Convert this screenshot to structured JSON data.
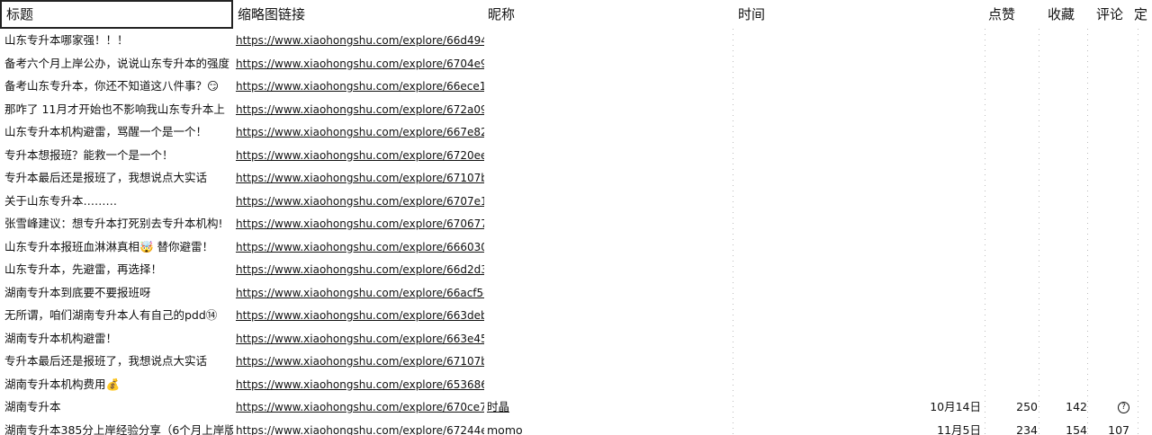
{
  "headers": {
    "title": "标题",
    "link": "缩略图链接",
    "nickname": "昵称",
    "time": "时间",
    "likes": "点赞",
    "favorites": "收藏",
    "comments": "评论",
    "more": "定"
  },
  "rows": [
    {
      "title": "山东专升本哪家强！！！",
      "link": "https://www.xiaohongshu.com/explore/66d4947200",
      "nickname": "",
      "time": "",
      "likes": "",
      "favorites": "",
      "comments": ""
    },
    {
      "title": "备考六个月上岸公办，说说山东专升本的强度",
      "link": "https://www.xiaohongshu.com/explore/6704e9a700",
      "nickname": "",
      "time": "",
      "likes": "",
      "favorites": "",
      "comments": ""
    },
    {
      "title": "备考山东专升本，你还不知道这八件事？😏",
      "link": "https://www.xiaohongshu.com/explore/66ece10800",
      "nickname": "",
      "time": "",
      "likes": "",
      "favorites": "",
      "comments": ""
    },
    {
      "title": "那咋了 11月才开始也不影响我山东专升本上",
      "link": "https://www.xiaohongshu.com/explore/672a09f900",
      "nickname": "",
      "time": "",
      "likes": "",
      "favorites": "",
      "comments": ""
    },
    {
      "title": "山东专升本机构避雷，骂醒一个是一个！",
      "link": "https://www.xiaohongshu.com/explore/667e822400",
      "nickname": "",
      "time": "",
      "likes": "",
      "favorites": "",
      "comments": ""
    },
    {
      "title": "专升本想报班？能救一个是一个！",
      "link": "https://www.xiaohongshu.com/explore/6720eebb00",
      "nickname": "",
      "time": "",
      "likes": "",
      "favorites": "",
      "comments": ""
    },
    {
      "title": "专升本最后还是报班了，我想说点大实话",
      "link": "https://www.xiaohongshu.com/explore/67107b0700",
      "nickname": "",
      "time": "",
      "likes": "",
      "favorites": "",
      "comments": ""
    },
    {
      "title": "关于山东专升本………",
      "link": "https://www.xiaohongshu.com/explore/6707e14c00",
      "nickname": "",
      "time": "",
      "likes": "",
      "favorites": "",
      "comments": ""
    },
    {
      "title": "张雪峰建议：想专升本打死别去专升本机构!",
      "link": "https://www.xiaohongshu.com/explore/6706773e00",
      "nickname": "",
      "time": "",
      "likes": "",
      "favorites": "",
      "comments": ""
    },
    {
      "title": "山东专升本报班血淋淋真相🤯 替你避雷！",
      "link": "https://www.xiaohongshu.com/explore/6660303e00",
      "nickname": "",
      "time": "",
      "likes": "",
      "favorites": "",
      "comments": ""
    },
    {
      "title": "山东专升本，先避雷，再选择！",
      "link": "https://www.xiaohongshu.com/explore/66d2d37900",
      "nickname": "",
      "time": "",
      "likes": "",
      "favorites": "",
      "comments": ""
    },
    {
      "title": "湖南专升本到底要不要报班呀",
      "link": "https://www.xiaohongshu.com/explore/66acf5d100",
      "nickname": "",
      "time": "",
      "likes": "",
      "favorites": "",
      "comments": ""
    },
    {
      "title": "无所谓，咱们湖南专升本人有自己的pdd⑭",
      "link": "https://www.xiaohongshu.com/explore/663debb200",
      "nickname": "",
      "time": "",
      "likes": "",
      "favorites": "",
      "comments": ""
    },
    {
      "title": "湖南专升本机构避雷！",
      "link": "https://www.xiaohongshu.com/explore/663e458d00",
      "nickname": "",
      "time": "",
      "likes": "",
      "favorites": "",
      "comments": ""
    },
    {
      "title": "专升本最后还是报班了，我想说点大实话",
      "link": "https://www.xiaohongshu.com/explore/67107b0700",
      "nickname": "",
      "time": "",
      "likes": "",
      "favorites": "",
      "comments": ""
    },
    {
      "title": "湖南专升本机构费用💰",
      "link": "https://www.xiaohongshu.com/explore/6536860e00",
      "nickname": "",
      "time": "",
      "likes": "",
      "favorites": "",
      "comments": ""
    },
    {
      "title": "湖南专升本",
      "link": "https://www.xiaohongshu.com/explore/670ce74100",
      "nickname": "时晶",
      "time": "10月14日",
      "likes": "250",
      "favorites": "142",
      "comments": "?"
    },
    {
      "title": "湖南专升本385分上岸经验分享（6个月上岸版",
      "link": "https://www.xiaohongshu.com/explore/67244e9",
      "nickname": "momo",
      "time": "11月5日",
      "likes": "234",
      "favorites": "154",
      "comments": "107"
    }
  ]
}
